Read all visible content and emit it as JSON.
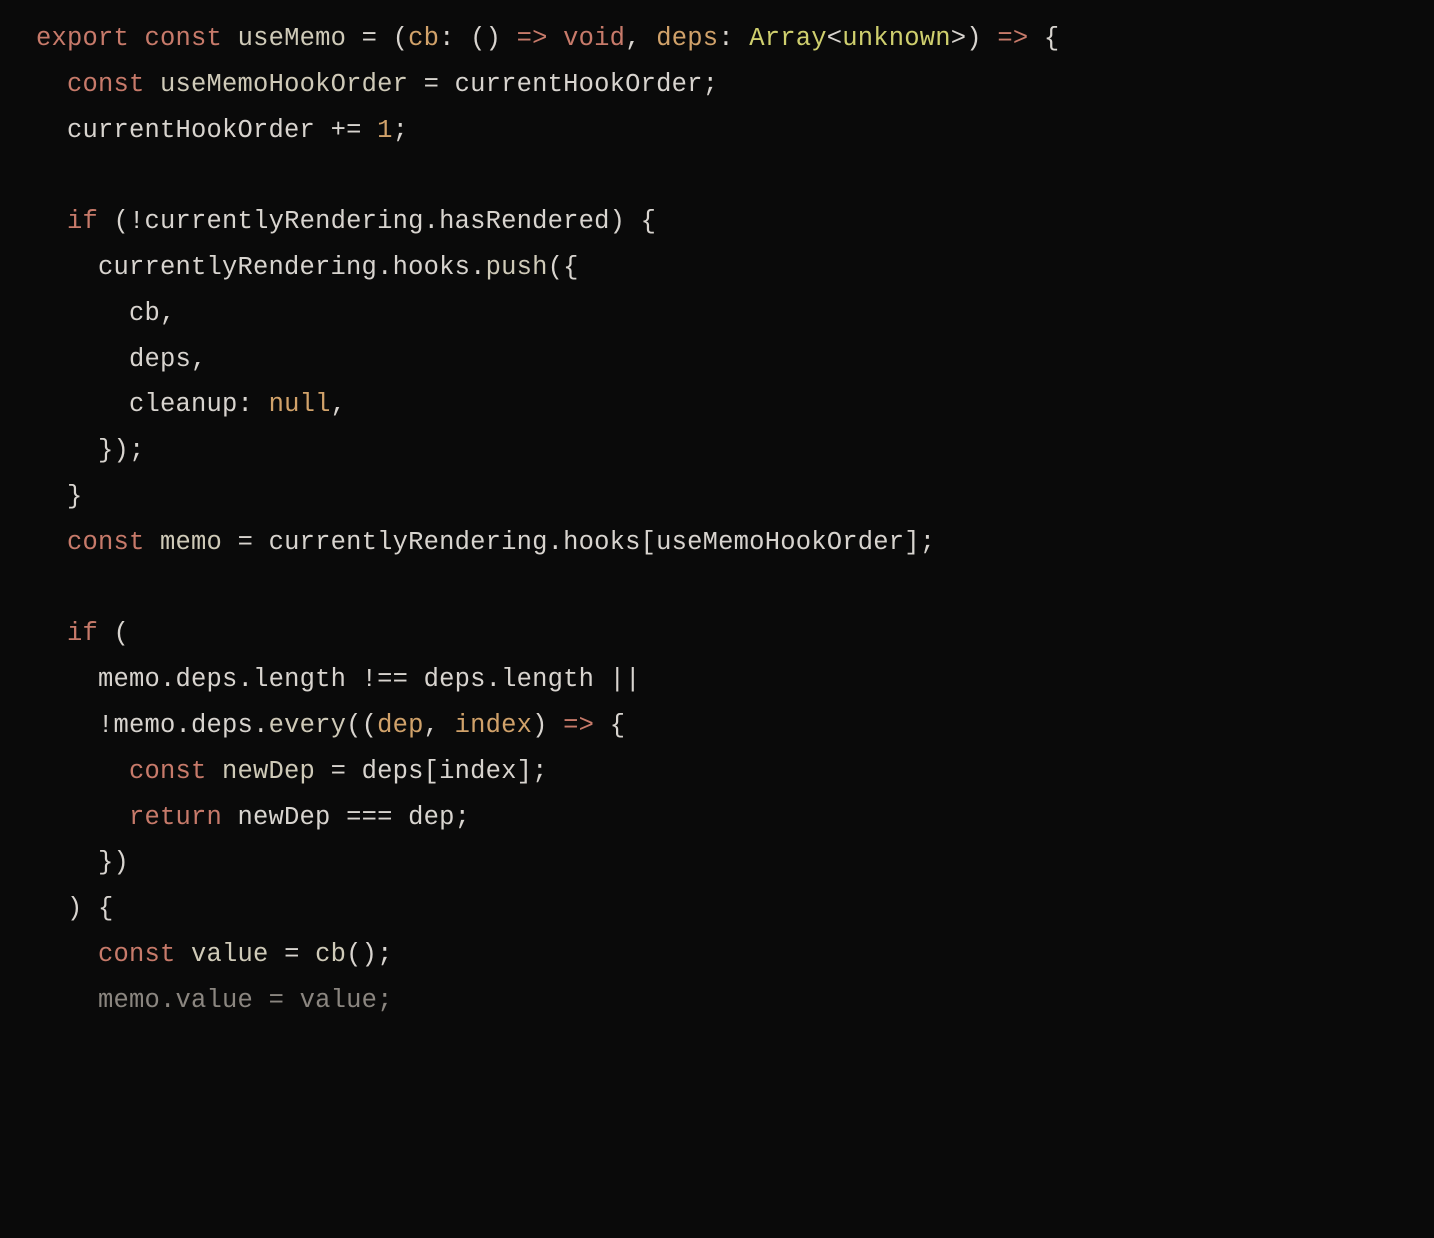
{
  "colors": {
    "background": "#0a0a0a",
    "default": "#d8d4cf",
    "keyword": "#c77a6a",
    "function": "#cfcab8",
    "param": "#d1a26a",
    "type": "#cfcf6e",
    "number": "#d1a26a",
    "null": "#d1a26a",
    "dim": "#8b8680"
  },
  "code": {
    "lines": [
      [
        {
          "t": "export",
          "c": "kw"
        },
        {
          "t": " ",
          "c": "punc"
        },
        {
          "t": "const",
          "c": "kw"
        },
        {
          "t": " ",
          "c": "punc"
        },
        {
          "t": "useMemo",
          "c": "fn"
        },
        {
          "t": " = (",
          "c": "punc"
        },
        {
          "t": "cb",
          "c": "param"
        },
        {
          "t": ": () ",
          "c": "punc"
        },
        {
          "t": "=>",
          "c": "kw"
        },
        {
          "t": " ",
          "c": "punc"
        },
        {
          "t": "void",
          "c": "kw"
        },
        {
          "t": ", ",
          "c": "punc"
        },
        {
          "t": "deps",
          "c": "param"
        },
        {
          "t": ": ",
          "c": "punc"
        },
        {
          "t": "Array",
          "c": "type"
        },
        {
          "t": "<",
          "c": "punc"
        },
        {
          "t": "unknown",
          "c": "type"
        },
        {
          "t": ">) ",
          "c": "punc"
        },
        {
          "t": "=>",
          "c": "kw"
        },
        {
          "t": " {",
          "c": "punc"
        }
      ],
      [
        {
          "t": "  ",
          "c": "punc"
        },
        {
          "t": "const",
          "c": "kw"
        },
        {
          "t": " ",
          "c": "punc"
        },
        {
          "t": "useMemoHookOrder",
          "c": "fn"
        },
        {
          "t": " = ",
          "c": "punc"
        },
        {
          "t": "currentHookOrder",
          "c": "var"
        },
        {
          "t": ";",
          "c": "punc"
        }
      ],
      [
        {
          "t": "  ",
          "c": "punc"
        },
        {
          "t": "currentHookOrder",
          "c": "var"
        },
        {
          "t": " += ",
          "c": "punc"
        },
        {
          "t": "1",
          "c": "num"
        },
        {
          "t": ";",
          "c": "punc"
        }
      ],
      [
        {
          "t": "",
          "c": "punc"
        }
      ],
      [
        {
          "t": "  ",
          "c": "punc"
        },
        {
          "t": "if",
          "c": "kw"
        },
        {
          "t": " (!",
          "c": "punc"
        },
        {
          "t": "currentlyRendering",
          "c": "var"
        },
        {
          "t": ".",
          "c": "punc"
        },
        {
          "t": "hasRendered",
          "c": "prop"
        },
        {
          "t": ") {",
          "c": "punc"
        }
      ],
      [
        {
          "t": "    ",
          "c": "punc"
        },
        {
          "t": "currentlyRendering",
          "c": "var"
        },
        {
          "t": ".",
          "c": "punc"
        },
        {
          "t": "hooks",
          "c": "prop"
        },
        {
          "t": ".",
          "c": "punc"
        },
        {
          "t": "push",
          "c": "fn"
        },
        {
          "t": "({",
          "c": "punc"
        }
      ],
      [
        {
          "t": "      ",
          "c": "punc"
        },
        {
          "t": "cb",
          "c": "var"
        },
        {
          "t": ",",
          "c": "punc"
        }
      ],
      [
        {
          "t": "      ",
          "c": "punc"
        },
        {
          "t": "deps",
          "c": "var"
        },
        {
          "t": ",",
          "c": "punc"
        }
      ],
      [
        {
          "t": "      ",
          "c": "punc"
        },
        {
          "t": "cleanup",
          "c": "var"
        },
        {
          "t": ": ",
          "c": "punc"
        },
        {
          "t": "null",
          "c": "null"
        },
        {
          "t": ",",
          "c": "punc"
        }
      ],
      [
        {
          "t": "    });",
          "c": "punc"
        }
      ],
      [
        {
          "t": "  }",
          "c": "punc"
        }
      ],
      [
        {
          "t": "  ",
          "c": "punc"
        },
        {
          "t": "const",
          "c": "kw"
        },
        {
          "t": " ",
          "c": "punc"
        },
        {
          "t": "memo",
          "c": "fn"
        },
        {
          "t": " = ",
          "c": "punc"
        },
        {
          "t": "currentlyRendering",
          "c": "var"
        },
        {
          "t": ".",
          "c": "punc"
        },
        {
          "t": "hooks",
          "c": "prop"
        },
        {
          "t": "[",
          "c": "punc"
        },
        {
          "t": "useMemoHookOrder",
          "c": "var"
        },
        {
          "t": "];",
          "c": "punc"
        }
      ],
      [
        {
          "t": "",
          "c": "punc"
        }
      ],
      [
        {
          "t": "  ",
          "c": "punc"
        },
        {
          "t": "if",
          "c": "kw"
        },
        {
          "t": " (",
          "c": "punc"
        }
      ],
      [
        {
          "t": "    ",
          "c": "punc"
        },
        {
          "t": "memo",
          "c": "var"
        },
        {
          "t": ".",
          "c": "punc"
        },
        {
          "t": "deps",
          "c": "prop"
        },
        {
          "t": ".",
          "c": "punc"
        },
        {
          "t": "length",
          "c": "prop"
        },
        {
          "t": " !== ",
          "c": "punc"
        },
        {
          "t": "deps",
          "c": "var"
        },
        {
          "t": ".",
          "c": "punc"
        },
        {
          "t": "length",
          "c": "prop"
        },
        {
          "t": " ||",
          "c": "punc"
        }
      ],
      [
        {
          "t": "    !",
          "c": "punc"
        },
        {
          "t": "memo",
          "c": "var"
        },
        {
          "t": ".",
          "c": "punc"
        },
        {
          "t": "deps",
          "c": "prop"
        },
        {
          "t": ".",
          "c": "punc"
        },
        {
          "t": "every",
          "c": "fn"
        },
        {
          "t": "((",
          "c": "punc"
        },
        {
          "t": "dep",
          "c": "param"
        },
        {
          "t": ", ",
          "c": "punc"
        },
        {
          "t": "index",
          "c": "param"
        },
        {
          "t": ") ",
          "c": "punc"
        },
        {
          "t": "=>",
          "c": "kw"
        },
        {
          "t": " {",
          "c": "punc"
        }
      ],
      [
        {
          "t": "      ",
          "c": "punc"
        },
        {
          "t": "const",
          "c": "kw"
        },
        {
          "t": " ",
          "c": "punc"
        },
        {
          "t": "newDep",
          "c": "fn"
        },
        {
          "t": " = ",
          "c": "punc"
        },
        {
          "t": "deps",
          "c": "var"
        },
        {
          "t": "[",
          "c": "punc"
        },
        {
          "t": "index",
          "c": "var"
        },
        {
          "t": "];",
          "c": "punc"
        }
      ],
      [
        {
          "t": "      ",
          "c": "punc"
        },
        {
          "t": "return",
          "c": "kw"
        },
        {
          "t": " ",
          "c": "punc"
        },
        {
          "t": "newDep",
          "c": "var"
        },
        {
          "t": " === ",
          "c": "punc"
        },
        {
          "t": "dep",
          "c": "var"
        },
        {
          "t": ";",
          "c": "punc"
        }
      ],
      [
        {
          "t": "    })",
          "c": "punc"
        }
      ],
      [
        {
          "t": "  ) {",
          "c": "punc"
        }
      ],
      [
        {
          "t": "    ",
          "c": "punc"
        },
        {
          "t": "const",
          "c": "kw"
        },
        {
          "t": " ",
          "c": "punc"
        },
        {
          "t": "value",
          "c": "fn"
        },
        {
          "t": " = ",
          "c": "punc"
        },
        {
          "t": "cb",
          "c": "fn"
        },
        {
          "t": "();",
          "c": "punc"
        }
      ],
      [
        {
          "t": "    ",
          "c": "dim"
        },
        {
          "t": "memo",
          "c": "dim"
        },
        {
          "t": ".",
          "c": "dim"
        },
        {
          "t": "value",
          "c": "dim"
        },
        {
          "t": " = ",
          "c": "dim"
        },
        {
          "t": "value",
          "c": "dim"
        },
        {
          "t": ";",
          "c": "dim"
        }
      ]
    ]
  }
}
